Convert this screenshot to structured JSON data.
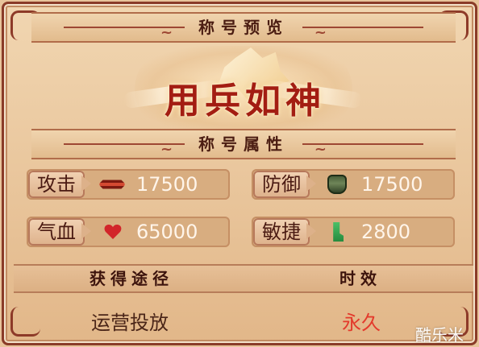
{
  "header": {
    "title": "称号预览",
    "banner_title": "用兵如神",
    "attributes_title": "称号属性"
  },
  "stats": [
    {
      "label": "攻击",
      "value": "17500",
      "icon": "sword-icon"
    },
    {
      "label": "防御",
      "value": "17500",
      "icon": "shield-icon"
    },
    {
      "label": "气血",
      "value": "65000",
      "icon": "heart-icon"
    },
    {
      "label": "敏捷",
      "value": "2800",
      "icon": "boot-icon"
    }
  ],
  "footer": {
    "source_label": "获得途径",
    "duration_label": "时效",
    "source_value": "运营投放",
    "duration_value": "永久"
  },
  "watermark": "酷乐米",
  "colors": {
    "frame": "#8a3b28",
    "accent_red": "#e33a2c",
    "text_dark": "#4a1a12"
  }
}
